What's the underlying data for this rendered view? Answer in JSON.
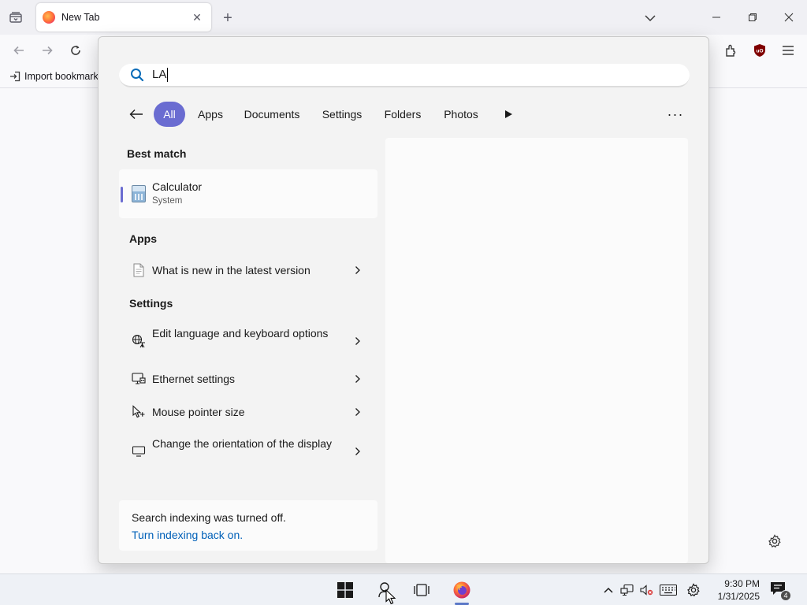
{
  "browser": {
    "tab": {
      "title": "New Tab",
      "close_glyph": "✕"
    },
    "new_tab_glyph": "+",
    "bookmarks_bar": {
      "import_label": "Import bookmark"
    },
    "icons": [
      "tabs-list-icon",
      "back-arrow-icon",
      "forward-arrow-icon",
      "reload-icon",
      "extensions-icon",
      "ublock-origin-icon",
      "hamburger-menu-icon",
      "page-settings-gear-icon"
    ]
  },
  "search": {
    "query": "LA",
    "filters": [
      "All",
      "Apps",
      "Documents",
      "Settings",
      "Folders",
      "Photos"
    ],
    "active_filter": "All",
    "more_glyph": "···",
    "best_match": {
      "heading": "Best match",
      "title": "Calculator",
      "subtitle": "System"
    },
    "apps": {
      "heading": "Apps",
      "items": [
        {
          "label": "What is new in the latest version"
        }
      ]
    },
    "settings": {
      "heading": "Settings",
      "items": [
        {
          "label": "Edit language and keyboard options",
          "icon": "language-icon"
        },
        {
          "label": "Ethernet settings",
          "icon": "ethernet-monitor-icon"
        },
        {
          "label": "Mouse pointer size",
          "icon": "mouse-pointer-icon"
        },
        {
          "label": "Change the orientation of the display",
          "icon": "display-icon"
        }
      ]
    },
    "indexing": {
      "message": "Search indexing was turned off.",
      "link": "Turn indexing back on."
    }
  },
  "taskbar": {
    "clock": {
      "time": "9:30 PM",
      "date": "1/31/2025"
    },
    "notification_count": "4",
    "accent": "#5b78c7"
  },
  "colors": {
    "accent": "#6a6cd1",
    "link": "#0060b8"
  }
}
